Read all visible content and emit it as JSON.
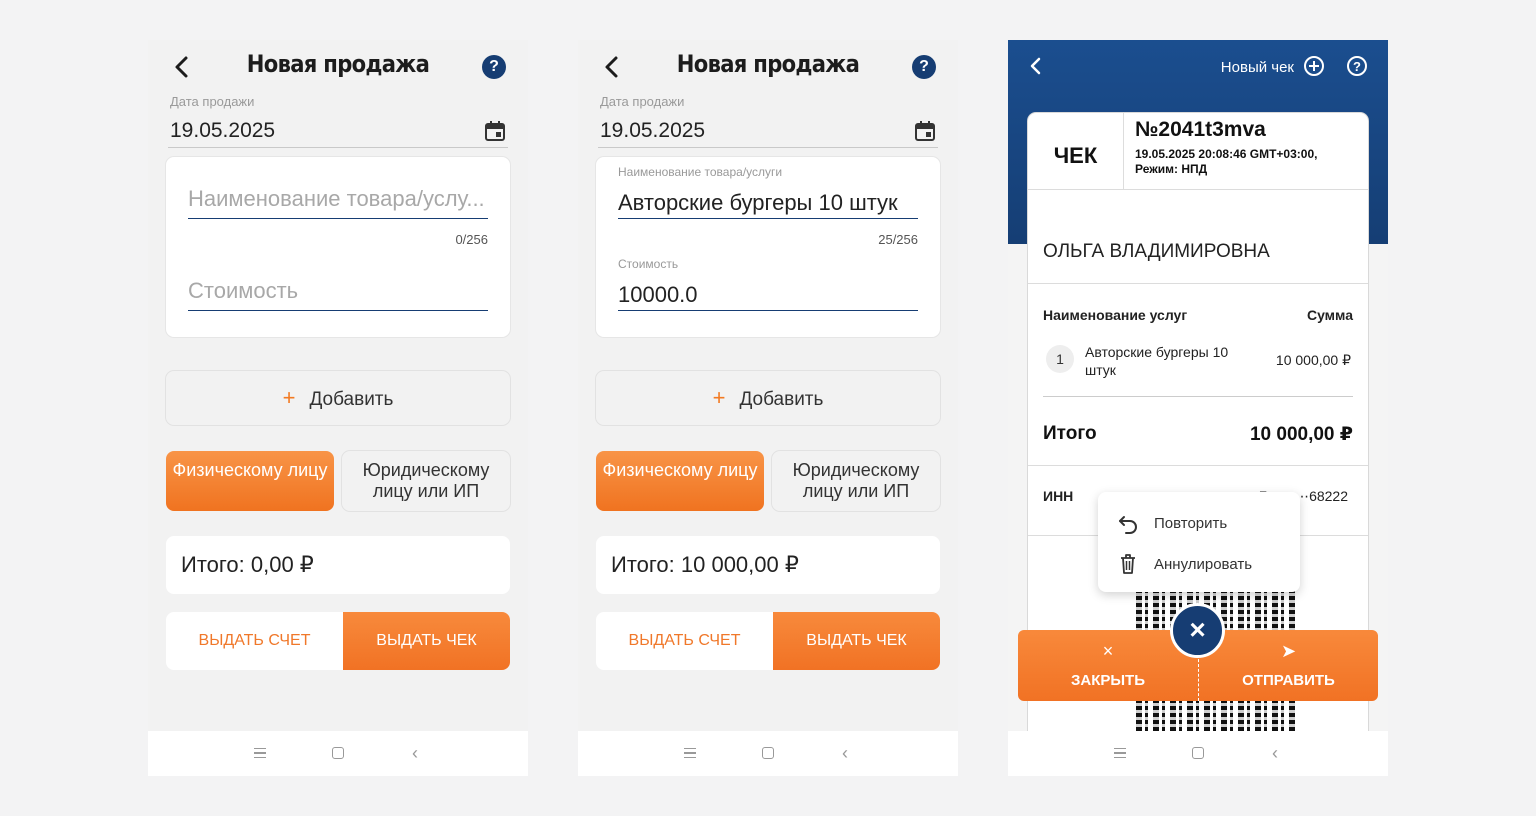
{
  "screens": [
    {
      "title": "Новая продажа",
      "help_icon": "?",
      "date_label": "Дата продажи",
      "date_value": "19.05.2025",
      "name_placeholder": "Наименование товара/услу...",
      "name_counter": "0/256",
      "cost_placeholder": "Стоимость",
      "add_label": "Добавить",
      "add_icon": "+",
      "seg_person_label": "Физическому лицу",
      "seg_company_label": "Юридическому лицу или ИП",
      "total": "Итого: 0,00 ₽",
      "invoice_button": "ВЫДАТЬ СЧЕТ",
      "receipt_button": "ВЫДАТЬ ЧЕК"
    },
    {
      "title": "Новая продажа",
      "help_icon": "?",
      "date_label": "Дата продажи",
      "date_value": "19.05.2025",
      "name_label": "Наименование товара/услуги",
      "name_value": "Авторские бургеры 10 штук",
      "name_counter": "25/256",
      "cost_label": "Стоимость",
      "cost_value": "10000.0",
      "add_label": "Добавить",
      "add_icon": "+",
      "seg_person_label": "Физическому лицу",
      "seg_company_label": "Юридическому лицу или ИП",
      "total": "Итого: 10 000,00 ₽",
      "invoice_button": "ВЫДАТЬ СЧЕТ",
      "receipt_button": "ВЫДАТЬ ЧЕК"
    }
  ],
  "receipt_screen": {
    "new_receipt_label": "Новый чек",
    "help_icon": "?",
    "receipt_title": "ЧЕК",
    "receipt_number": "№2041t3mva",
    "receipt_datetime": "19.05.2025 20:08:46 GMT+03:00, Режим: НПД",
    "buyer_name": "ОЛЬГА ВЛАДИМИРОВНА",
    "services_header": "Наименование услуг",
    "sum_header": "Сумма",
    "item_index": "1",
    "item_name": "Авторские бургеры 10 штук",
    "item_price": "10 000,00 ₽",
    "total_label": "Итого",
    "total_value": "10 000,00 ₽",
    "inn_label": "ИНН",
    "inn_value": "7⋯⋯⋯68222",
    "menu_repeat": "Повторить",
    "menu_cancel": "Аннулировать",
    "close_label": "ЗАКРЫТЬ",
    "close_icon": "×",
    "send_label": "ОТПРАВИТЬ",
    "send_icon": "➤",
    "fab_icon": "×"
  },
  "colors": {
    "accent_orange": "#f37a22",
    "navy": "#163d73",
    "header_blue": "#1b4e8f"
  }
}
